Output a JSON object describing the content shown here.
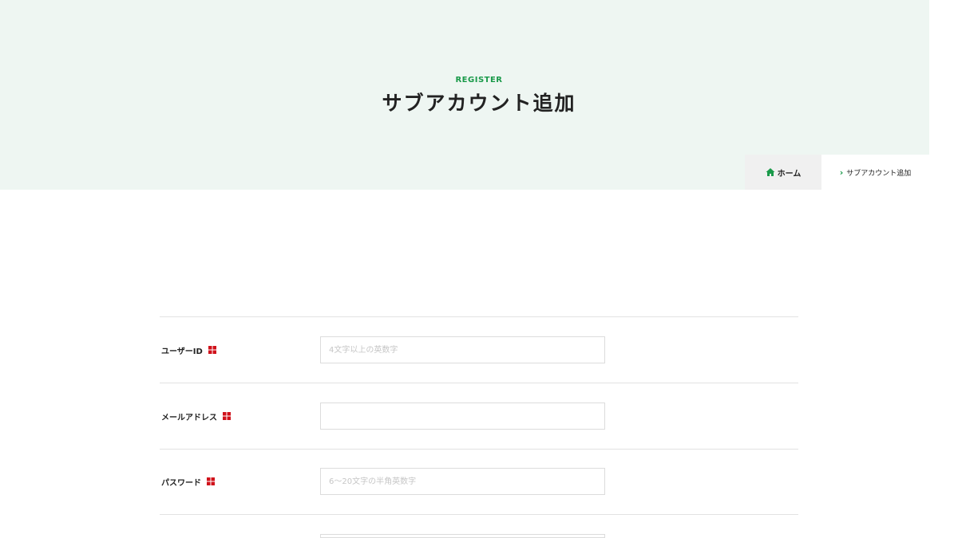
{
  "hero": {
    "eyebrow": "REGISTER",
    "title": "サブアカウント追加"
  },
  "breadcrumb": {
    "home_label": "ホーム",
    "current_label": "サブアカウント追加"
  },
  "form": {
    "fields": [
      {
        "label": "ユーザーID",
        "placeholder": "4文字以上の英数字",
        "value": "",
        "required": true
      },
      {
        "label": "メールアドレス",
        "placeholder": "",
        "value": "",
        "required": true
      },
      {
        "label": "パスワード",
        "placeholder": "6〜20文字の半角英数字",
        "value": "",
        "required": true
      },
      {
        "label": "",
        "placeholder": "",
        "value": "",
        "required": false
      }
    ]
  },
  "colors": {
    "accent_green": "#1a9a4a",
    "required_red": "#d0121b",
    "hero_bg": "#eef6f2",
    "breadcrumb_home_bg": "#f0f0f0"
  },
  "icons": {
    "home": "home-icon",
    "chevron": "chevron-right-icon",
    "required": "required-mark-icon"
  }
}
